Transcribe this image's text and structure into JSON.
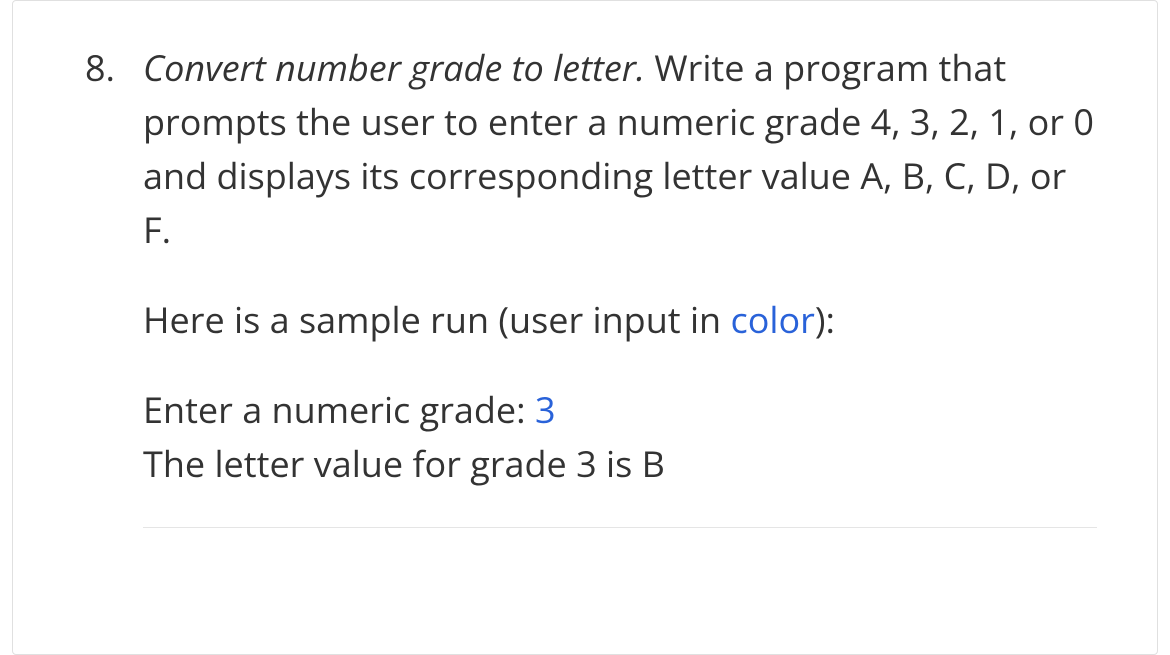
{
  "item": {
    "number": "8.",
    "title_italic": "Convert number grade to letter.",
    "body_rest": " Write a program that prompts the user to enter a numeric grade 4, 3, 2, 1, or 0 and displays its corresponding letter value A, B, C, D, or F.",
    "sample_intro_prefix": "Here is a sample run (user input in ",
    "sample_intro_color_word": "color",
    "sample_intro_suffix": "):",
    "sample_line1_prefix": "Enter a numeric grade: ",
    "sample_line1_input": "3",
    "sample_line2": "The letter value for grade 3 is B"
  }
}
